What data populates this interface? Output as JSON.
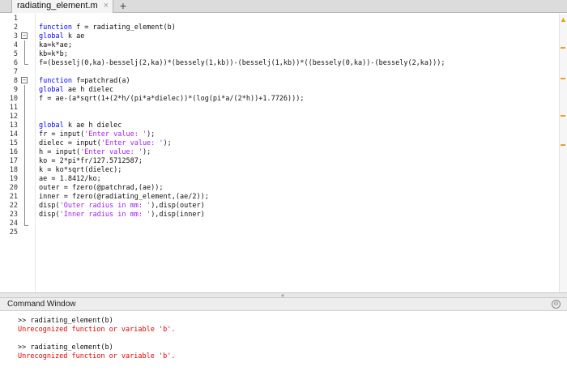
{
  "tabs": [
    {
      "label": "radiating_element.m",
      "close": "×"
    }
  ],
  "tab_add": "+",
  "editor": {
    "lines": [
      {
        "n": "1",
        "text": ""
      },
      {
        "n": "2",
        "text": "function f = radiating_element(b)"
      },
      {
        "n": "3",
        "text": "global k ae"
      },
      {
        "n": "4",
        "text": "ka=k*ae;"
      },
      {
        "n": "5",
        "text": "kb=k*b;"
      },
      {
        "n": "6",
        "text": "f=(besselj(0,ka)-besselj(2,ka))*(bessely(1,kb))-(besselj(1,kb))*((bessely(0,ka))-(bessely(2,ka)));"
      },
      {
        "n": "7",
        "text": ""
      },
      {
        "n": "8",
        "text": "function f=patchrad(a)"
      },
      {
        "n": "9",
        "text": "global ae h dielec"
      },
      {
        "n": "10",
        "text": "f = ae-(a*sqrt(1+(2*h/(pi*a*dielec))*(log(pi*a/(2*h))+1.7726)));"
      },
      {
        "n": "11",
        "text": ""
      },
      {
        "n": "12",
        "text": ""
      },
      {
        "n": "13",
        "text": "global k ae h dielec"
      },
      {
        "n": "14",
        "text": "fr = input('Enter value: ');"
      },
      {
        "n": "15",
        "text": "dielec = input('Enter value: ');"
      },
      {
        "n": "16",
        "text": "h = input('Enter value: ');"
      },
      {
        "n": "17",
        "text": "ko = 2*pi*fr/127.5712587;"
      },
      {
        "n": "18",
        "text": "k = ko*sqrt(dielec);"
      },
      {
        "n": "19",
        "text": "ae = 1.8412/ko;"
      },
      {
        "n": "20",
        "text": "outer = fzero(@patchrad,(ae));"
      },
      {
        "n": "21",
        "text": "inner = fzero(@radiating_element,(ae/2));"
      },
      {
        "n": "22",
        "text": "disp('Outer radius in mm: '),disp(outer)"
      },
      {
        "n": "23",
        "text": "disp('Inner radius in mm: '),disp(inner)"
      },
      {
        "n": "24",
        "text": ""
      },
      {
        "n": "25",
        "text": ""
      }
    ],
    "warning_icon": "warning-triangle"
  },
  "command_window": {
    "title": "Command Window",
    "menu_icon": "⊙",
    "lines": [
      {
        "text": ">> radiating_element(b)",
        "type": "input"
      },
      {
        "text": "Unrecognized function or variable 'b'.",
        "type": "error"
      },
      {
        "text": "",
        "type": "blank"
      },
      {
        "text": ">> radiating_element(b)",
        "type": "input"
      },
      {
        "text": "Unrecognized function or variable 'b'.",
        "type": "error"
      }
    ]
  },
  "colors": {
    "keyword": "#0000ff",
    "string": "#a020f0",
    "error": "#e00000",
    "warning": "#e8a000"
  }
}
